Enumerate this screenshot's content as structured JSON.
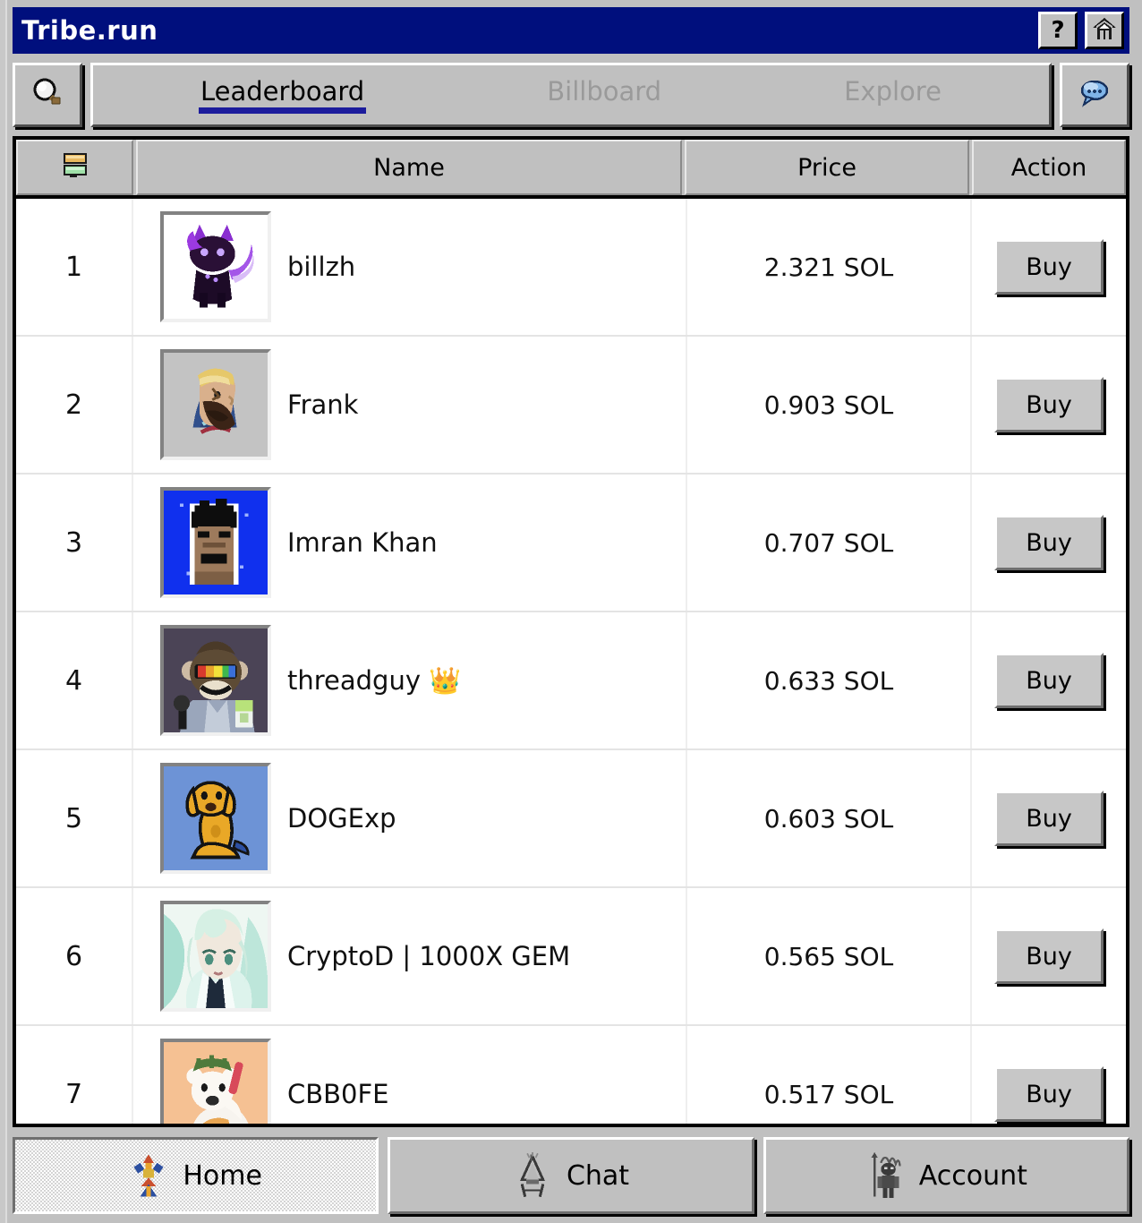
{
  "window": {
    "title": "Tribe.run",
    "help_button_label": "?",
    "home_button_icon": "home-icon"
  },
  "toolbar": {
    "search_icon": "magnifier-icon",
    "chat_icon": "speech-bubble-icon",
    "tabs": [
      {
        "label": "Leaderboard",
        "active": true
      },
      {
        "label": "Billboard",
        "active": false
      },
      {
        "label": "Explore",
        "active": false
      }
    ]
  },
  "table": {
    "columns": {
      "rank_icon": "rank-stack-icon",
      "name": "Name",
      "price": "Price",
      "action": "Action"
    },
    "rows": [
      {
        "rank": "1",
        "name": "billzh",
        "price": "2.321 SOL",
        "action": "Buy",
        "avatar": "purple-cat-avatar"
      },
      {
        "rank": "2",
        "name": "Frank",
        "price": "0.903 SOL",
        "action": "Buy",
        "avatar": "bearded-man-avatar"
      },
      {
        "rank": "3",
        "name": "Imran Khan",
        "price": "0.707 SOL",
        "action": "Buy",
        "avatar": "pixel-face-blue-avatar"
      },
      {
        "rank": "4",
        "name": "threadguy 👑",
        "price": "0.633 SOL",
        "action": "Buy",
        "avatar": "ape-rainbow-visor-avatar"
      },
      {
        "rank": "5",
        "name": "DOGExp",
        "price": "0.603 SOL",
        "action": "Buy",
        "avatar": "yellow-dog-avatar"
      },
      {
        "rank": "6",
        "name": "CryptoD | 1000X GEM",
        "price": "0.565 SOL",
        "action": "Buy",
        "avatar": "mint-hair-anime-avatar"
      },
      {
        "rank": "7",
        "name": "CBB0FE",
        "price": "0.517 SOL",
        "action": "Buy",
        "avatar": "white-bear-orange-avatar"
      }
    ]
  },
  "bottom_nav": [
    {
      "label": "Home",
      "icon": "tribal-totem-icon",
      "active": true
    },
    {
      "label": "Chat",
      "icon": "tribal-tent-icon",
      "active": false
    },
    {
      "label": "Account",
      "icon": "tribal-chief-icon",
      "active": false
    }
  ],
  "colors": {
    "titlebar": "#000f7d",
    "chrome": "#c0c0c0",
    "tab_underline": "#1c1c9c",
    "tab_inactive_text": "#9a9a9a"
  }
}
